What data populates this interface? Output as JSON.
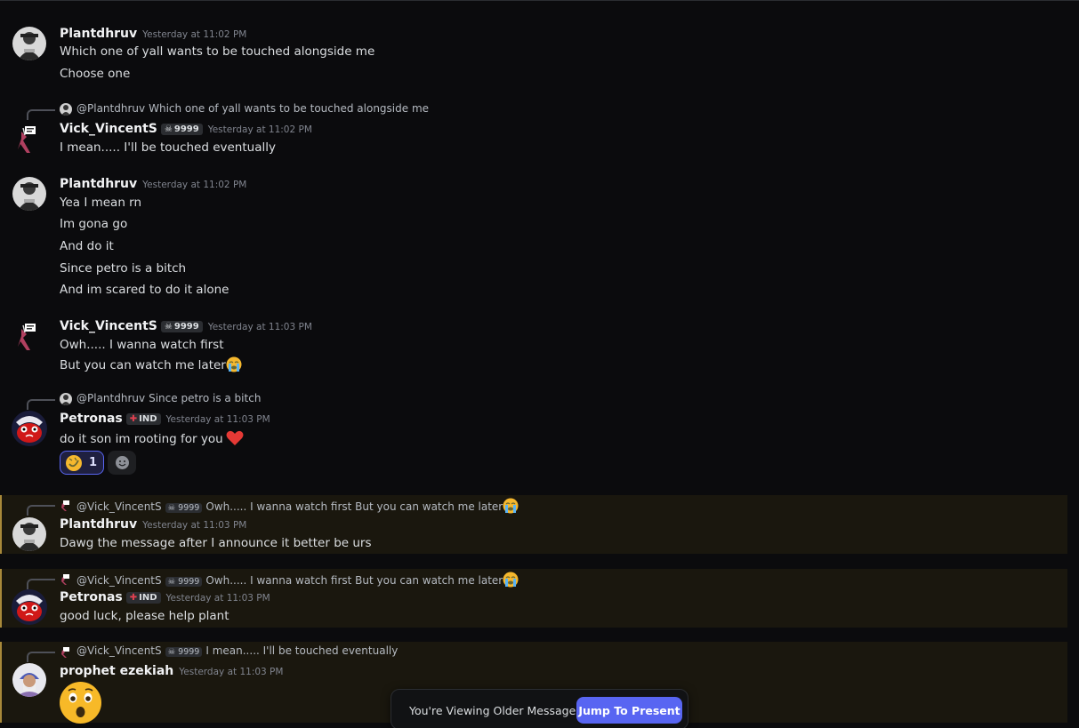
{
  "colors": {
    "background": "#0b0b0d",
    "mention_highlight": "#1a170e",
    "mention_border": "#a8893a",
    "accent": "#5865f2",
    "heart": "#e53935"
  },
  "messages": [
    {
      "author": "Plantdhruv",
      "timestamp": "Yesterday at 11:02 PM",
      "lines": [
        "Which one of yall wants to be touched alongside me",
        "Choose one"
      ]
    },
    {
      "reply": {
        "name": "@Plantdhruv",
        "text": "Which one of yall wants to be touched alongside me"
      },
      "author": "Vick_VincentS",
      "tag": {
        "icon": "skull-icon",
        "label": "9999"
      },
      "timestamp": "Yesterday at 11:02 PM",
      "lines": [
        "I mean..... I'll be touched eventually"
      ]
    },
    {
      "author": "Plantdhruv",
      "timestamp": "Yesterday at 11:02 PM",
      "lines": [
        "Yea I mean rn",
        "Im gona go",
        "And do it",
        "Since petro is a bitch",
        "And im scared to do it alone"
      ]
    },
    {
      "author": "Vick_VincentS",
      "tag": {
        "icon": "skull-icon",
        "label": "9999"
      },
      "timestamp": "Yesterday at 11:03 PM",
      "lines": [
        "Owh..... I wanna watch first",
        "But you can watch me later"
      ],
      "trailing_emoji": "loudly-crying-face-icon"
    },
    {
      "reply": {
        "name": "@Plantdhruv",
        "text": "Since petro is a bitch"
      },
      "author": "Petronas",
      "tag": {
        "icon": "flag-icon",
        "label": "IND"
      },
      "timestamp": "Yesterday at 11:03 PM",
      "lines": [
        "do it son im rooting for you"
      ],
      "trailing_emoji": "red-heart-icon",
      "reactions": [
        {
          "emoji": "rofl-icon",
          "count": "1"
        }
      ]
    },
    {
      "highlighted": true,
      "reply": {
        "name": "@Vick_VincentS",
        "tag": "9999",
        "text": "Owh..... I wanna watch first But you can watch me later"
      },
      "author": "Plantdhruv",
      "timestamp": "Yesterday at 11:03 PM",
      "lines": [
        "Dawg the message after I announce it better be urs"
      ]
    },
    {
      "highlighted": true,
      "reply": {
        "name": "@Vick_VincentS",
        "tag": "9999",
        "text": "Owh..... I wanna watch first But you can watch me later"
      },
      "author": "Petronas",
      "tag": {
        "icon": "flag-icon",
        "label": "IND"
      },
      "timestamp": "Yesterday at 11:03 PM",
      "lines": [
        "good luck, please help plant"
      ]
    },
    {
      "highlighted": true,
      "reply": {
        "name": "@Vick_VincentS",
        "tag": "9999",
        "text": "I mean..... I'll be touched eventually"
      },
      "author": "prophet ezekiah",
      "timestamp": "Yesterday at 11:03 PM",
      "big_emoji": "astonished-face-icon"
    }
  ],
  "toast": {
    "text": "You're Viewing Older Messages",
    "button": "Jump To Present"
  }
}
